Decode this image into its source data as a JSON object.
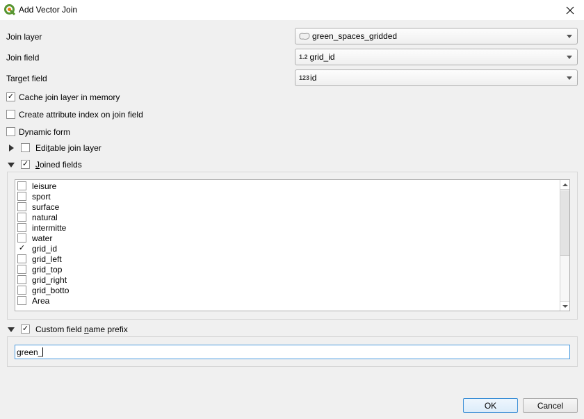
{
  "window": {
    "title": "Add Vector Join",
    "close_icon": "close-x-icon"
  },
  "form": {
    "join_layer": {
      "label": "Join layer",
      "value": "green_spaces_gridded",
      "icon": "polygon-layer-icon"
    },
    "join_field": {
      "label": "Join field",
      "value": "grid_id",
      "type_tag": "1.2"
    },
    "target_field": {
      "label": "Target field",
      "value": "id",
      "type_tag": "123"
    }
  },
  "options": {
    "cache": {
      "label": "Cache join layer in memory",
      "checked": true
    },
    "index": {
      "label": "Create attribute index on join field",
      "checked": false
    },
    "dynamic": {
      "label": "Dynamic form",
      "checked": false
    },
    "editable": {
      "label_pre": "Edi",
      "label_ul": "t",
      "label_post": "able join layer",
      "checked": false,
      "expanded": false
    },
    "joined": {
      "label_ul": "J",
      "label_post": "oined fields",
      "checked": true,
      "expanded": true
    }
  },
  "joined_fields": [
    {
      "name": "leisure",
      "checked": false
    },
    {
      "name": "sport",
      "checked": false
    },
    {
      "name": "surface",
      "checked": false
    },
    {
      "name": "natural",
      "checked": false
    },
    {
      "name": "intermitte",
      "checked": false
    },
    {
      "name": "water",
      "checked": false
    },
    {
      "name": "grid_id",
      "checked": true
    },
    {
      "name": "grid_left",
      "checked": false
    },
    {
      "name": "grid_top",
      "checked": false
    },
    {
      "name": "grid_right",
      "checked": false
    },
    {
      "name": "grid_botto",
      "checked": false
    },
    {
      "name": "Area",
      "checked": false
    }
  ],
  "prefix": {
    "label_pre": "Custom field ",
    "label_ul": "n",
    "label_post": "ame prefix",
    "checked": true,
    "expanded": true,
    "value": "green_"
  },
  "buttons": {
    "ok": "OK",
    "cancel": "Cancel"
  },
  "colors": {
    "accent": "#3c8fd6",
    "background": "#f0f0f0"
  }
}
